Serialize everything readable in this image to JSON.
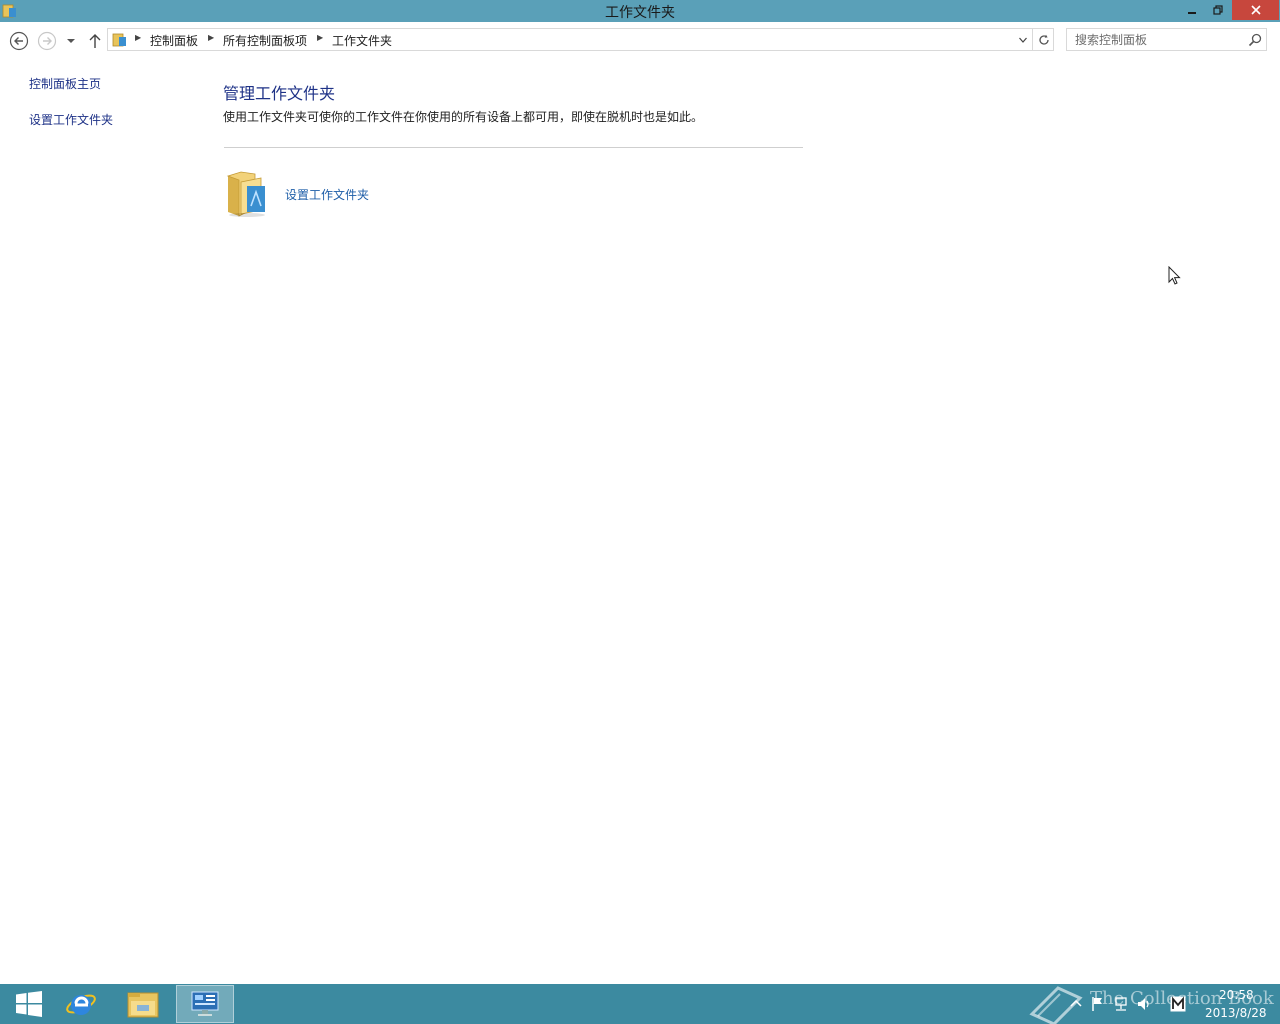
{
  "window": {
    "title": "工作文件夹",
    "controls": {
      "minimize": "minimize",
      "maximize": "maximize",
      "close": "close"
    }
  },
  "navigation": {
    "breadcrumbs": [
      "控制面板",
      "所有控制面板项",
      "工作文件夹"
    ],
    "search_placeholder": "搜索控制面板"
  },
  "left_pane": {
    "links": [
      "控制面板主页",
      "设置工作文件夹"
    ]
  },
  "main": {
    "title": "管理工作文件夹",
    "description": "使用工作文件夹可使你的工作文件在你使用的所有设备上都可用，即使在脱机时也是如此。",
    "task_link": "设置工作文件夹"
  },
  "taskbar": {
    "pinned": [
      "start",
      "internet-explorer",
      "file-explorer",
      "control-panel"
    ],
    "active": "control-panel",
    "clock_time": "20:58",
    "clock_date": "2013/8/28",
    "watermark": "The Collection Book"
  },
  "colors": {
    "titlebar": "#5aa0b8",
    "close_button": "#c7473d",
    "link": "#1e3287",
    "taskbar": "#3c8aa0"
  }
}
